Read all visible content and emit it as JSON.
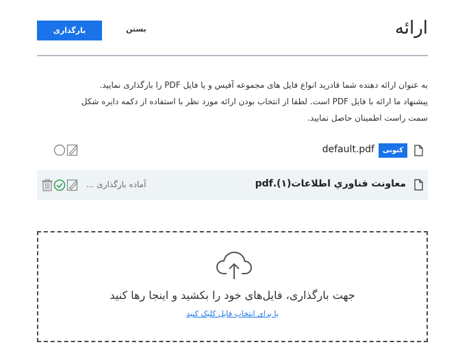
{
  "header": {
    "title": "ارائه",
    "upload_button": "بارگذاری",
    "close_button": "بستن"
  },
  "description": {
    "line1": "به عنوان ارائه دهنده شما قادرید انواع فایل های مجموعه آفیس و یا فایل PDF را بارگذاری نمایید.",
    "line2": "پیشنهاد ما ارائه با فایل PDF است. لطفا از انتخاب بودن ارائه مورد نظر با استفاده از دکمه دایره شکل",
    "line3": "سمت راست اطمینان حاصل نمایید."
  },
  "files": [
    {
      "name": "default.pdf",
      "badge": "کنونی",
      "icons": [
        "document-icon",
        "annotate-icon",
        "radio-unselected-icon"
      ]
    },
    {
      "name": "معاونت فناوري اطلاعات(۱).pdf",
      "status": "آماده بارگذاری ...",
      "icons": [
        "document-icon",
        "annotate-icon",
        "radio-selected-icon",
        "trash-icon"
      ]
    }
  ],
  "dropzone": {
    "icon": "cloud-upload-icon",
    "main_text": "جهت بارگذاری، فایل‌های خود را بکشید و اینجا رها کنید",
    "link_text": "یا برای انتخاب فایل کلیک کنید"
  },
  "colors": {
    "accent": "#1a73e8",
    "selected_green": "#2e9e47",
    "highlight_row": "#eef3f6"
  }
}
